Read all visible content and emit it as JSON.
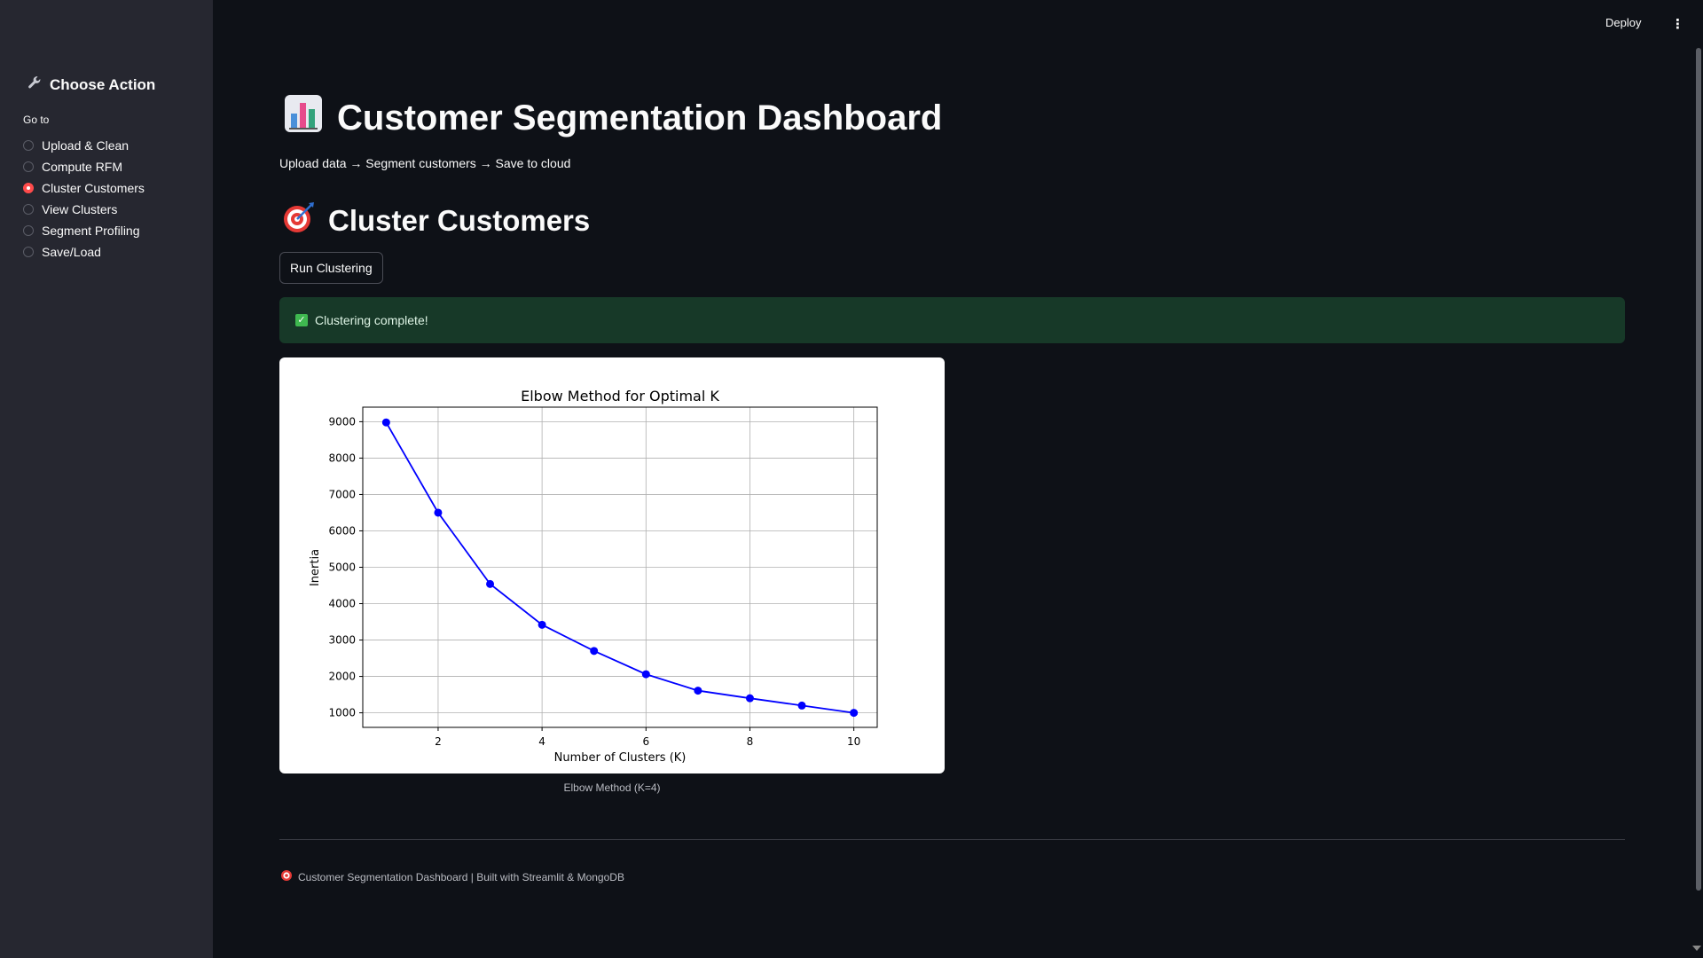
{
  "sidebar": {
    "title": "Choose Action",
    "title_icon": "wrench-icon",
    "goto_label": "Go to",
    "items": [
      {
        "label": "Upload & Clean",
        "selected": false
      },
      {
        "label": "Compute RFM",
        "selected": false
      },
      {
        "label": "Cluster Customers",
        "selected": true
      },
      {
        "label": "View Clusters",
        "selected": false
      },
      {
        "label": "Segment Profiling",
        "selected": false
      },
      {
        "label": "Save/Load",
        "selected": false
      }
    ]
  },
  "header": {
    "deploy_label": "Deploy",
    "menu_icon": "kebab-menu-icon"
  },
  "main": {
    "title": "Customer Segmentation Dashboard",
    "title_icon": "bar-chart-icon",
    "subtitle": "Upload data → Segment customers → Save to cloud",
    "section_title": "Cluster Customers",
    "section_icon": "target-icon",
    "run_button_label": "Run Clustering",
    "success_message": "Clustering complete!",
    "caption": "Elbow Method (K=4)",
    "footer": "Customer Segmentation Dashboard | Built with Streamlit & MongoDB"
  },
  "colors": {
    "accent": "#ff4b4b",
    "background": "#0e1117",
    "sidebar": "#262730",
    "success_bg": "#173928",
    "line": "#0000ff"
  },
  "chart_data": {
    "type": "line",
    "title": "Elbow Method for Optimal K",
    "xlabel": "Number of Clusters (K)",
    "ylabel": "Inertia",
    "x": [
      1,
      2,
      3,
      4,
      5,
      6,
      7,
      8,
      9,
      10
    ],
    "series": [
      {
        "values": [
          8980,
          6500,
          4540,
          3420,
          2700,
          2060,
          1610,
          1400,
          1200,
          1000
        ]
      }
    ],
    "xticks": [
      2,
      4,
      6,
      8,
      10
    ],
    "yticks": [
      1000,
      2000,
      3000,
      4000,
      5000,
      6000,
      7000,
      8000,
      9000
    ],
    "xlim": [
      0.55,
      10.45
    ],
    "ylim": [
      600,
      9400
    ],
    "grid": true,
    "marker": "circle"
  }
}
